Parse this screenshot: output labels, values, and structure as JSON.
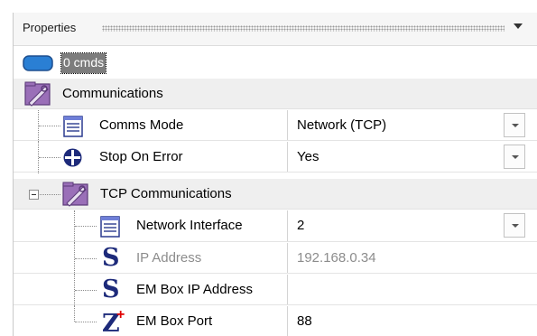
{
  "panel": {
    "title": "Properties"
  },
  "command_node": {
    "label": "0 cmds",
    "icon": "rounded-rectangle-icon",
    "icon_color": "#2a7fd4"
  },
  "categories": {
    "communications": "Communications",
    "tcp": "TCP Communications"
  },
  "properties": {
    "comms_mode": {
      "label": "Comms Mode",
      "value": "Network (TCP)"
    },
    "stop_on_error": {
      "label": "Stop On Error",
      "value": "Yes"
    },
    "network_interface": {
      "label": "Network Interface",
      "value": "2"
    },
    "ip_address": {
      "label": "IP Address",
      "value": "192.168.0.34"
    },
    "em_box_ip": {
      "label": "EM Box IP Address",
      "value": ""
    },
    "em_box_port": {
      "label": "EM Box Port",
      "value": "88"
    }
  },
  "colors": {
    "accent_blue": "#1d2a7a",
    "category_bg": "#efefef",
    "disabled_text": "#8c8c8c",
    "star_red": "#e00000"
  }
}
